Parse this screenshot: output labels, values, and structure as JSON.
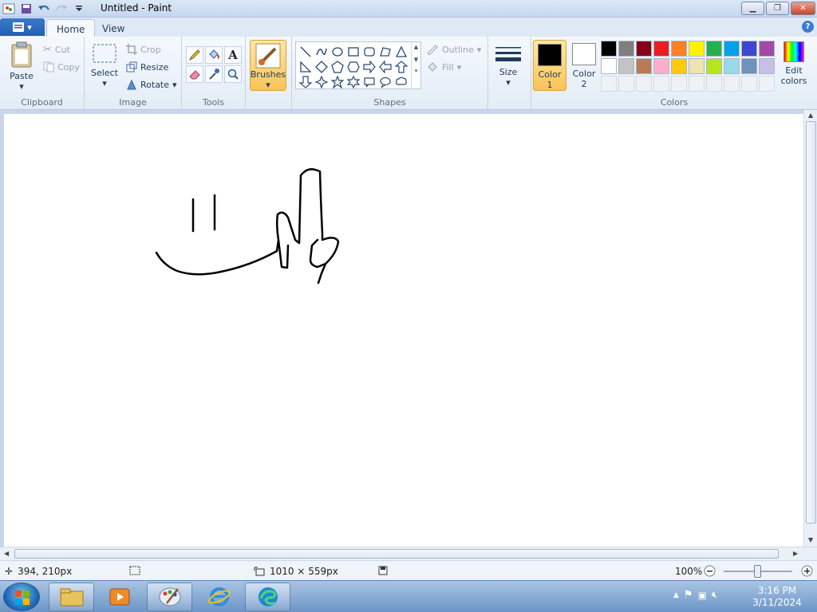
{
  "window": {
    "title": "Untitled - Paint"
  },
  "tabs": {
    "file_icon": "menu-icon",
    "home": "Home",
    "view": "View"
  },
  "ribbon": {
    "clipboard": {
      "label": "Clipboard",
      "paste": "Paste",
      "cut": "Cut",
      "copy": "Copy"
    },
    "image": {
      "label": "Image",
      "select": "Select",
      "crop": "Crop",
      "resize": "Resize",
      "rotate": "Rotate"
    },
    "tools": {
      "label": "Tools",
      "text_glyph": "A"
    },
    "brushes": {
      "label": "Brushes"
    },
    "shapes": {
      "label": "Shapes",
      "outline": "Outline",
      "fill": "Fill"
    },
    "size": {
      "label": "Size"
    },
    "colors": {
      "label": "Colors",
      "color1_label": "Color",
      "color1_num": "1",
      "color2_label": "Color",
      "color2_num": "2",
      "color1": "#000000",
      "color2": "#ffffff",
      "edit_label_1": "Edit",
      "edit_label_2": "colors",
      "palette_row1": [
        "#000000",
        "#7f7f7f",
        "#880015",
        "#ed1c24",
        "#ff7f27",
        "#fff200",
        "#22b14c",
        "#00a2e8",
        "#3f48cc",
        "#a349a4"
      ],
      "palette_row2": [
        "#ffffff",
        "#c3c3c3",
        "#b97a57",
        "#ffaec9",
        "#ffc90e",
        "#efe4b0",
        "#b5e61d",
        "#99d9ea",
        "#7092be",
        "#c8bfe7"
      ]
    }
  },
  "status": {
    "cursor_pos": "394, 210px",
    "canvas_size": "1010 × 559px",
    "zoom": "100%"
  },
  "taskbar": {
    "time": "3:16 PM",
    "date": "3/11/2024"
  }
}
